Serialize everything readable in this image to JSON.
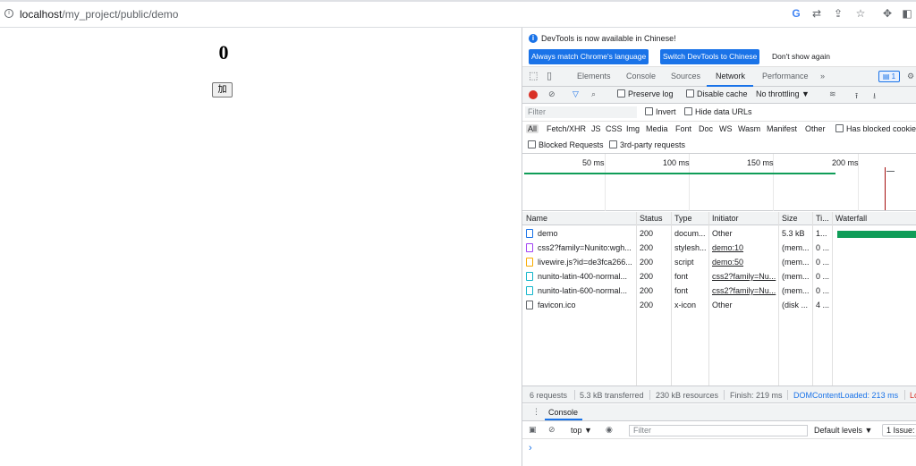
{
  "browser": {
    "url_host": "localhost",
    "url_path": "/my_project/public/demo"
  },
  "page": {
    "counter": "0",
    "button_label": "加"
  },
  "devtools": {
    "info_text": "DevTools is now available in Chinese!",
    "btn_match": "Always match Chrome's language",
    "btn_switch": "Switch DevTools to Chinese",
    "btn_dont_show": "Don't show again",
    "tabs": [
      "Elements",
      "Console",
      "Sources",
      "Network",
      "Performance"
    ],
    "more_tabs": "»",
    "issues_badge": "1",
    "preserve_log": "Preserve log",
    "disable_cache": "Disable cache",
    "throttling": "No throttling",
    "filter_placeholder": "Filter",
    "invert": "Invert",
    "hide_data_urls": "Hide data URLs",
    "types": [
      "All",
      "Fetch/XHR",
      "JS",
      "CSS",
      "Img",
      "Media",
      "Font",
      "Doc",
      "WS",
      "Wasm",
      "Manifest",
      "Other"
    ],
    "has_blocked_cookies": "Has blocked cookies",
    "blocked_requests": "Blocked Requests",
    "third_party": "3rd-party requests",
    "overview_ticks": [
      "50 ms",
      "100 ms",
      "150 ms",
      "200 ms"
    ],
    "columns": [
      "Name",
      "Status",
      "Type",
      "Initiator",
      "Size",
      "Ti...",
      "Waterfall"
    ],
    "rows": [
      {
        "name": "demo",
        "status": "200",
        "type": "docum...",
        "initiator": "Other",
        "size": "5.3 kB",
        "time": "1...",
        "icon_color": "#1a73e8"
      },
      {
        "name": "css2?family=Nunito:wgh...",
        "status": "200",
        "type": "stylesh...",
        "initiator": "demo:10",
        "size": "(mem...",
        "time": "0 ...",
        "icon_color": "#a142f4"
      },
      {
        "name": "livewire.js?id=de3fca266...",
        "status": "200",
        "type": "script",
        "initiator": "demo:50",
        "size": "(mem...",
        "time": "0 ...",
        "icon_color": "#f9ab00"
      },
      {
        "name": "nunito-latin-400-normal...",
        "status": "200",
        "type": "font",
        "initiator": "css2?family=Nu...",
        "size": "(mem...",
        "time": "0 ...",
        "icon_color": "#12b5cb"
      },
      {
        "name": "nunito-latin-600-normal...",
        "status": "200",
        "type": "font",
        "initiator": "css2?family=Nu...",
        "size": "(mem...",
        "time": "0 ...",
        "icon_color": "#12b5cb"
      },
      {
        "name": "favicon.ico",
        "status": "200",
        "type": "x-icon",
        "initiator": "Other",
        "size": "(disk ...",
        "time": "4 ...",
        "icon_color": "#5f6368"
      }
    ],
    "status_bar": {
      "requests": "6 requests",
      "transferred": "5.3 kB transferred",
      "resources": "230 kB resources",
      "finish": "Finish: 219 ms",
      "dom_loaded": "DOMContentLoaded: 213 ms",
      "load": "Lo"
    },
    "console": {
      "tab": "Console",
      "context": "top",
      "filter_placeholder": "Filter",
      "levels": "Default levels",
      "issues": "1 Issue:",
      "prompt": "›"
    }
  }
}
